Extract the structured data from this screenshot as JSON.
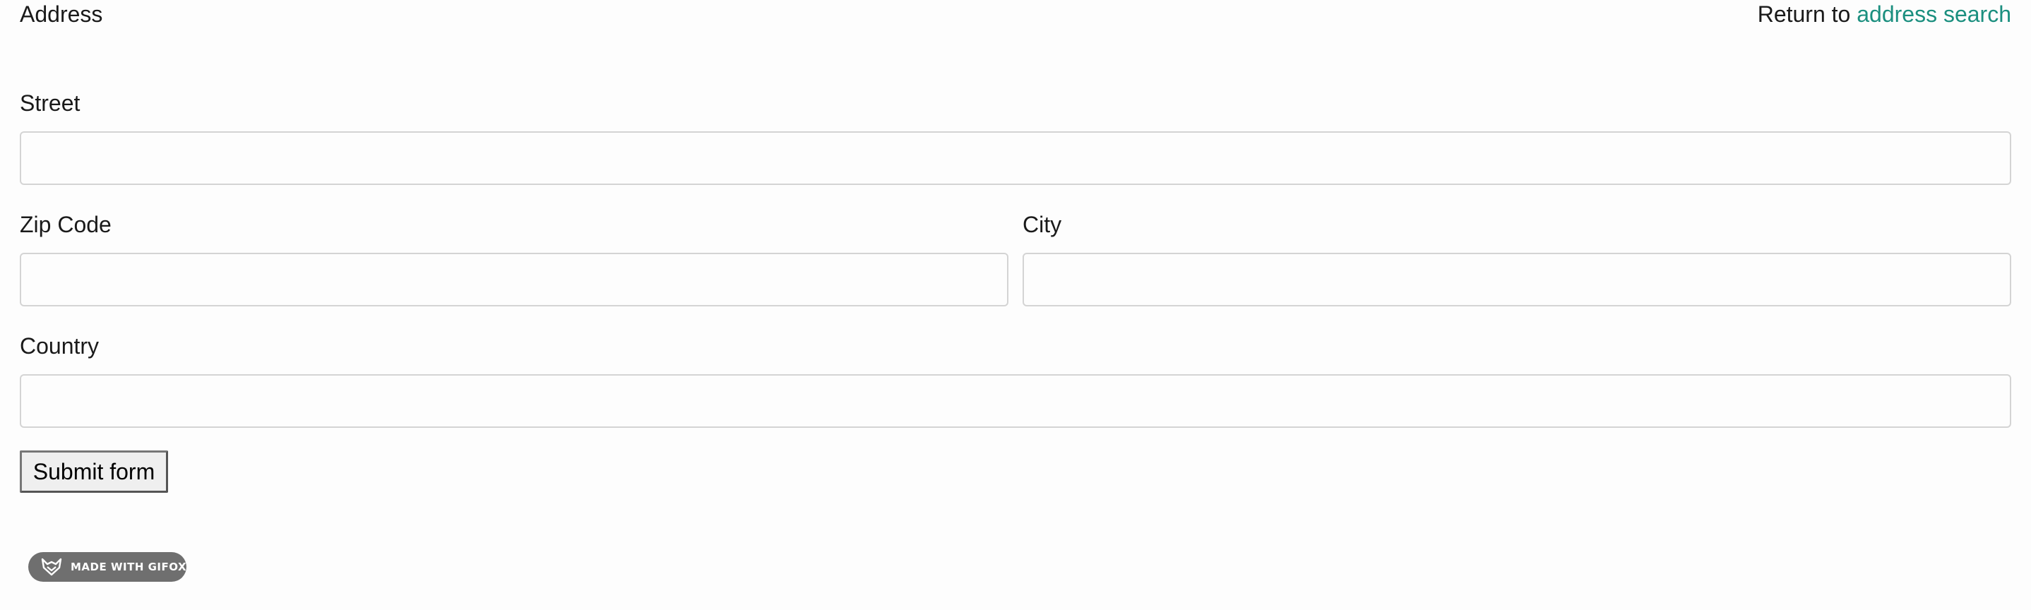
{
  "header": {
    "title": "Address",
    "return_prefix": "Return to",
    "return_link": "address search"
  },
  "form": {
    "street_label": "Street",
    "street_value": "",
    "zip_label": "Zip Code",
    "zip_value": "",
    "city_label": "City",
    "city_value": "",
    "country_label": "Country",
    "country_value": "",
    "submit_label": "Submit form"
  },
  "watermark": {
    "text": "MADE WITH GIFOX",
    "icon": "fox-icon"
  },
  "colors": {
    "link": "#1b8f7f",
    "field_border": "#d4d4d4",
    "badge_background": "#6f6f6f"
  }
}
